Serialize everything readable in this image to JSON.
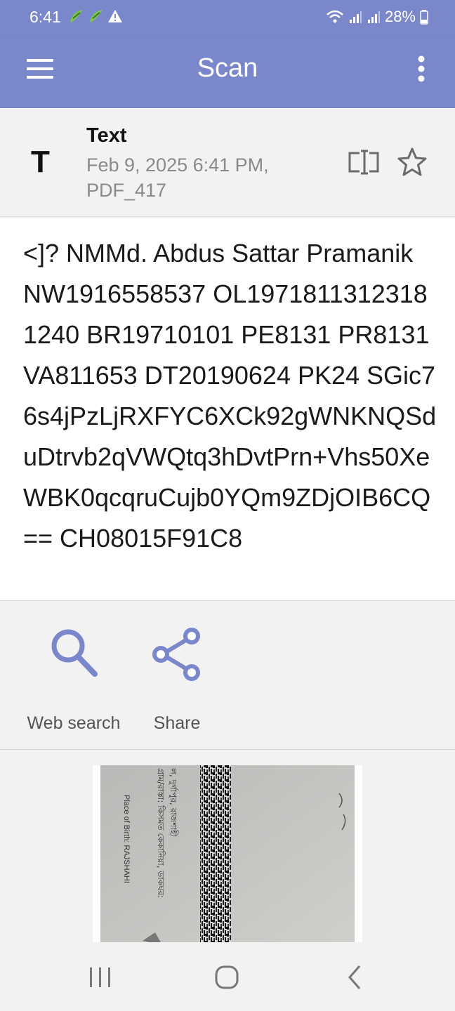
{
  "status_bar": {
    "time": "6:41",
    "battery": "28%",
    "icons": [
      "notification-icon",
      "notification-icon",
      "warning-icon",
      "wifi-icon",
      "signal-icon",
      "signal-icon",
      "battery-icon"
    ]
  },
  "app_bar": {
    "title": "Scan",
    "menu_icon": "hamburger-menu-icon",
    "more_icon": "more-vert-icon",
    "color": "#7b87cb"
  },
  "result": {
    "type_icon": "T",
    "type_label": "Text",
    "date": "Feb 9, 2025 6:41 PM,",
    "format": "PDF_417",
    "text": "<]? NMMd. Abdus Sattar Pramanik NW1916558537 OL19718113123181240 BR19710101 PE8131 PR8131 VA811653 DT20190624 PK24 SGic76s4jPzLjRXFYC6XCk92gWNKNQSduDtrvb2qVWQtq3hDvtPrn+Vhs50XeWBK0qcqruCujb0YQm9ZDjOIB6CQ== CH08015F91C8"
  },
  "actions": [
    {
      "label": "Web search",
      "icon": "search-icon"
    },
    {
      "label": "Share",
      "icon": "share-icon"
    }
  ],
  "scan_image": {
    "text_lines": [
      "Place of Birth: RAJSHAHI"
    ],
    "bengali_lines": [
      "গ্রাম/রাস্তা: কিসমত কেকানিয়া, ডাকঘর:",
      "ল, দুর্গাপুর, রাজশাহী"
    ]
  },
  "accent_color": "#7b87cb"
}
